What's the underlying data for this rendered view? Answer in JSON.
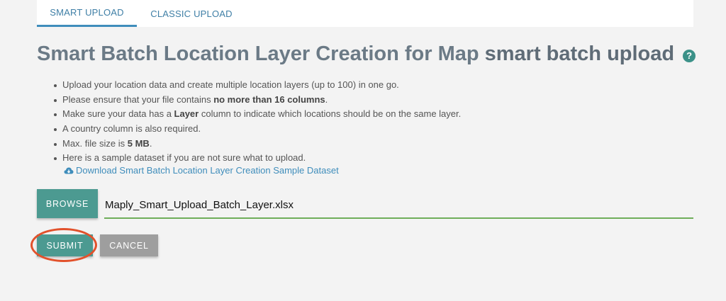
{
  "tabs": {
    "smart": "SMART UPLOAD",
    "classic": "CLASSIC UPLOAD"
  },
  "title": {
    "main": "Smart Batch Location Layer Creation for Map",
    "bold": "smart batch upload",
    "help": "?"
  },
  "bullets": {
    "b1": "Upload your location data and create multiple location layers (up to 100) in one go.",
    "b2_pre": "Please ensure that your file contains ",
    "b2_bold": "no more than 16 columns",
    "b2_post": ".",
    "b3_pre": "Make sure your data has a ",
    "b3_bold": "Layer",
    "b3_post": " column to indicate which locations should be on the same layer.",
    "b4": "A country column is also required.",
    "b5_pre": "Max. file size is ",
    "b5_bold": "5 MB",
    "b5_post": ".",
    "b6": "Here is a sample dataset if you are not sure what to upload."
  },
  "download_link": "Download Smart Batch Location Layer Creation Sample Dataset",
  "upload": {
    "browse_label": "BROWSE",
    "file_name": "Maply_Smart_Upload_Batch_Layer.xlsx"
  },
  "actions": {
    "submit_label": "SUBMIT",
    "cancel_label": "CANCEL"
  },
  "colors": {
    "accent": "#4c9a91",
    "link": "#3f8dbb",
    "highlight": "#e2512b",
    "field_underline": "#6fae5a"
  }
}
